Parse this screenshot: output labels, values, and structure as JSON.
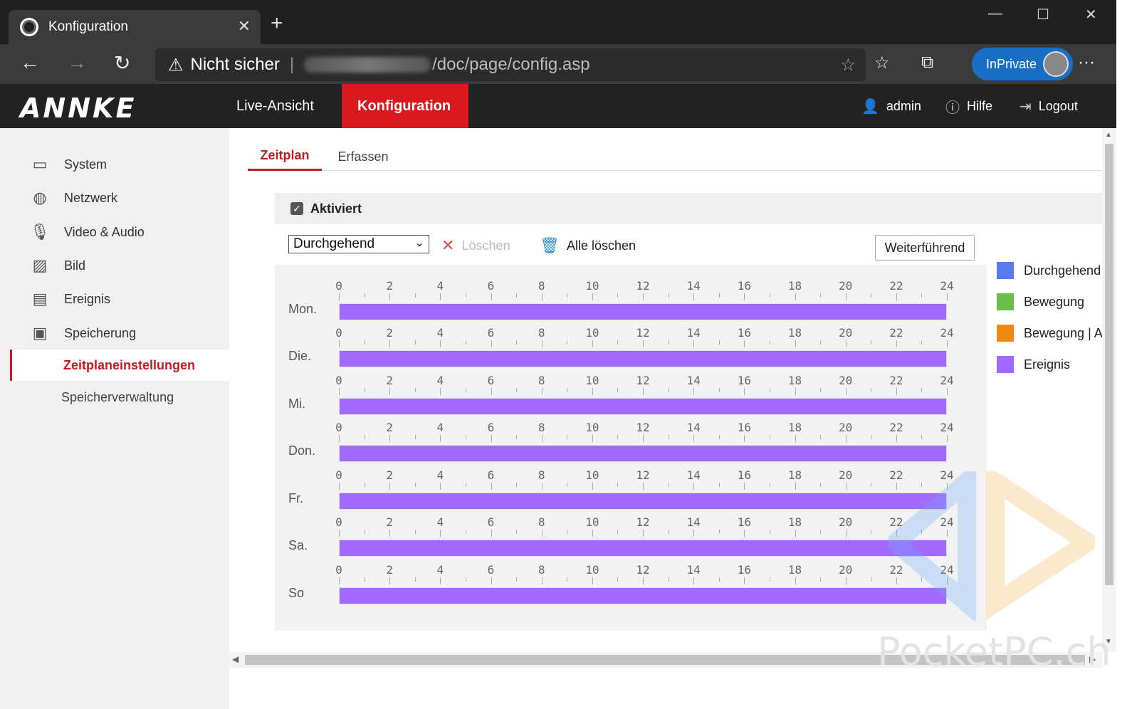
{
  "browser": {
    "tab_title": "Konfiguration",
    "tab_close": "✕",
    "new_tab": "+",
    "win_min": "—",
    "win_max": "☐",
    "win_close": "✕",
    "back": "←",
    "forward": "→",
    "reload": "↻",
    "security_label": "Nicht sicher",
    "url_path": "/doc/page/config.asp",
    "inprivate_label": "InPrivate",
    "more": "···"
  },
  "app": {
    "logo": "ANNKE",
    "nav": [
      {
        "label": "Live-Ansicht"
      },
      {
        "label": "Konfiguration"
      }
    ],
    "user": "admin",
    "help": "Hilfe",
    "logout": "Logout"
  },
  "sidebar": {
    "items": [
      {
        "label": "System"
      },
      {
        "label": "Netzwerk"
      },
      {
        "label": "Video & Audio"
      },
      {
        "label": "Bild"
      },
      {
        "label": "Ereignis"
      },
      {
        "label": "Speicherung"
      }
    ],
    "sub_items": [
      {
        "label": "Zeitplaneinstellungen"
      },
      {
        "label": "Speicherverwaltung"
      }
    ]
  },
  "content": {
    "tabs": [
      {
        "label": "Zeitplan"
      },
      {
        "label": "Erfassen"
      }
    ],
    "enabled_label": "Aktiviert",
    "mode_select": "Durchgehend",
    "delete_label": "Löschen",
    "delete_all_label": "Alle löschen",
    "advanced_label": "Weiterführend"
  },
  "schedule": {
    "hours": [
      "0",
      "2",
      "4",
      "6",
      "8",
      "10",
      "12",
      "14",
      "16",
      "18",
      "20",
      "22",
      "24"
    ],
    "days": [
      {
        "label": "Mon.",
        "start": 0,
        "end": 24
      },
      {
        "label": "Die.",
        "start": 0,
        "end": 24
      },
      {
        "label": "Mi.",
        "start": 0,
        "end": 24
      },
      {
        "label": "Don.",
        "start": 0,
        "end": 24
      },
      {
        "label": "Fr.",
        "start": 0,
        "end": 24
      },
      {
        "label": "Sa.",
        "start": 0,
        "end": 24
      },
      {
        "label": "So",
        "start": 0,
        "end": 24
      }
    ]
  },
  "legend": [
    {
      "label": "Durchgehend",
      "color": "#5b7cf0"
    },
    {
      "label": "Bewegung",
      "color": "#6cbf4a"
    },
    {
      "label": "Bewegung | A",
      "color": "#ec8a12"
    },
    {
      "label": "Ereignis",
      "color": "#a26bff"
    }
  ],
  "watermark": "PocketPC.ch"
}
